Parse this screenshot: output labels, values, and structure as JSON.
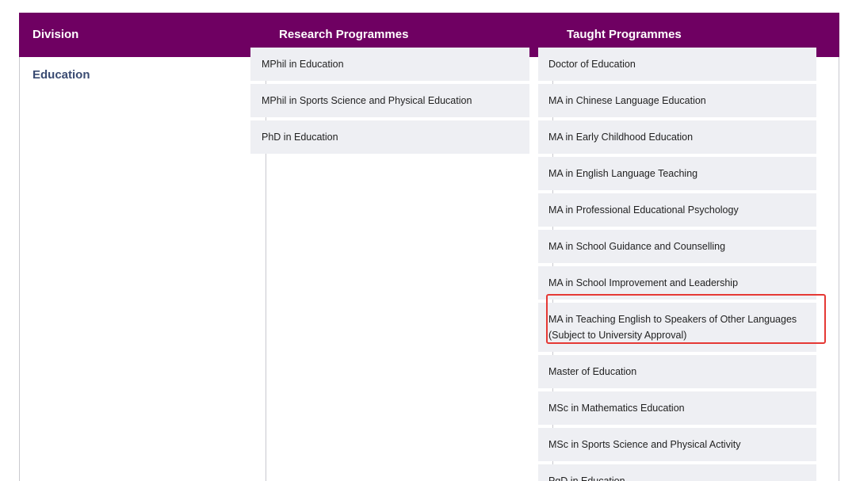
{
  "table": {
    "headers": {
      "division": "Division",
      "research": "Research Programmes",
      "taught": "Taught Programmes"
    },
    "division": "Education",
    "research_programmes": [
      "MPhil in Education",
      "MPhil in Sports Science and Physical Education",
      "PhD in Education"
    ],
    "taught_programmes": [
      "Doctor of Education",
      "MA in Chinese Language Education",
      "MA in Early Childhood Education",
      "MA in English Language Teaching",
      "MA in Professional Educational Psychology",
      "MA in School Guidance and Counselling",
      "MA in School Improvement and Leadership",
      "MA in Teaching English to Speakers of Other Languages (Subject to University Approval)",
      "Master of Education",
      "MSc in Mathematics Education",
      "MSc in Sports Science and Physical Activity",
      "PgD in Education"
    ]
  },
  "colors": {
    "header_bg": "#6f0062",
    "cell_bg": "#eeeff3",
    "division_text": "#3a4b72",
    "highlight_border": "#e53935"
  }
}
